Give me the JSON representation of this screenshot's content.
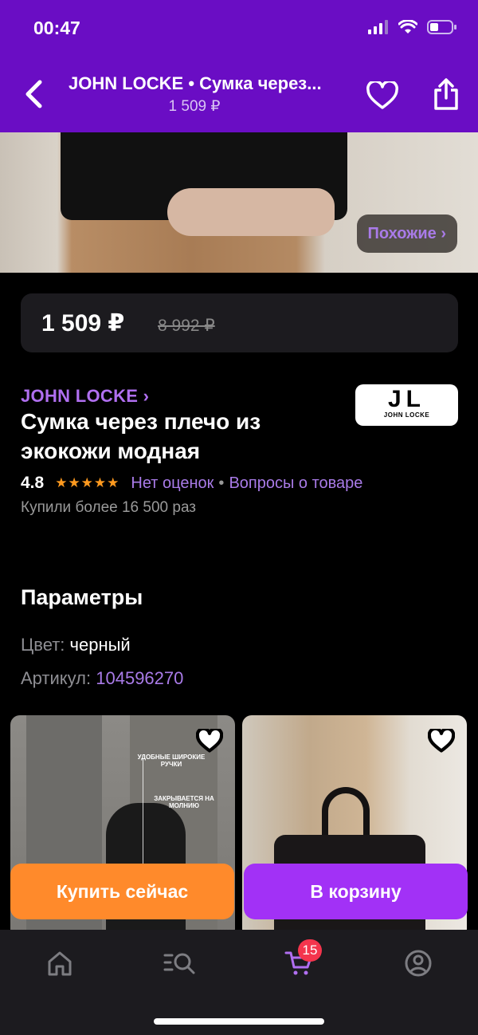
{
  "status_bar": {
    "time": "00:47"
  },
  "header": {
    "title": "JOHN LOCKE • Сумка через...",
    "subtitle_price": "1 509 ₽"
  },
  "hero": {
    "similar_label": "Похожие ›"
  },
  "price_card": {
    "price": "1 509 ₽",
    "old_price": "8 992 ₽"
  },
  "product": {
    "brand_link": "JOHN LOCKE ›",
    "brand_logo_letters": "JL",
    "brand_logo_name": "JOHN LOCKE",
    "title": "Сумка через плечо из экокожи модная",
    "rating": "4.8",
    "stars": "★★★★★",
    "no_reviews": "Нет оценок",
    "separator": "•",
    "questions": "Вопросы о товаре",
    "bought": "Купили более 16 500 раз"
  },
  "params": {
    "title": "Параметры",
    "color_label": "Цвет:",
    "color_value": " черный",
    "article_label": "Артикул:",
    "article_value": " 104596270"
  },
  "cards": [
    {
      "tag1_a": "УДОБНЫЕ",
      "tag1_b": "ШИРОКИЕ",
      "tag1_c": "РУЧКИ",
      "tag2_a": "ЗАКРЫВАЕТСЯ НА",
      "tag2_b": "МОЛНИЮ"
    }
  ],
  "actions": {
    "buy_now": "Купить сейчас",
    "to_cart": "В корзину"
  },
  "tab_bar": {
    "cart_badge": "15"
  },
  "colors": {
    "accent": "#6a0dc4",
    "link": "#a97be8",
    "buy": "#ff8a2b",
    "cart": "#a231f6",
    "badge": "#f4354d"
  }
}
